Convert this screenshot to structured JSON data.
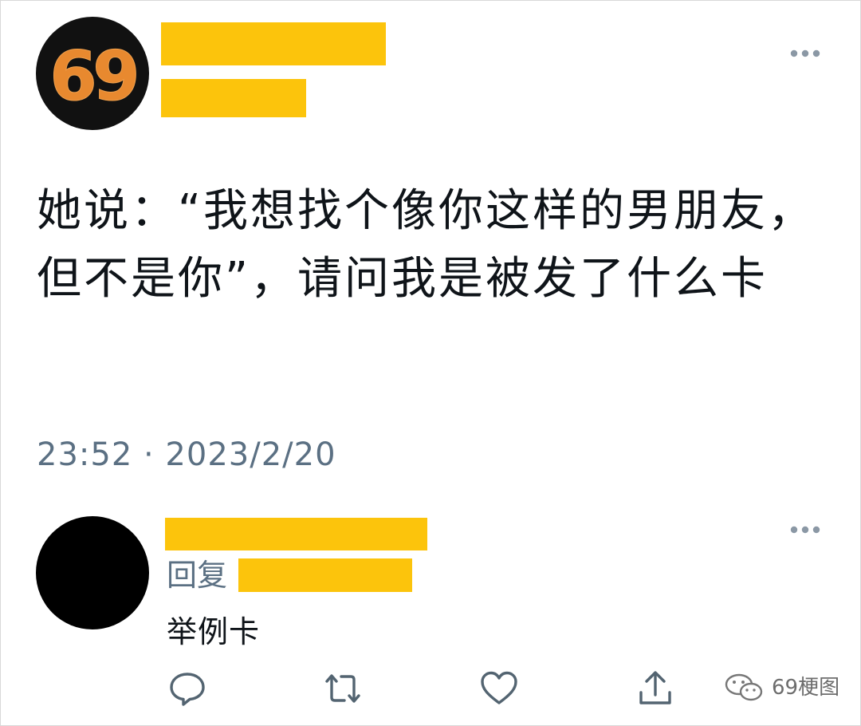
{
  "tweet": {
    "avatar_logo_text": "69",
    "text": "她说：“我想找个像你这样的男朋友，但不是你”，请问我是被发了什么卡",
    "timestamp": "23:52 · 2023/2/20",
    "menu_icon": "more-horizontal-icon"
  },
  "reply": {
    "reply_label": "回复",
    "text": "举例卡",
    "menu_icon": "more-horizontal-icon"
  },
  "actions": [
    {
      "name": "reply",
      "icon": "speech-bubble-icon"
    },
    {
      "name": "retweet",
      "icon": "retweet-icon"
    },
    {
      "name": "like",
      "icon": "heart-icon"
    },
    {
      "name": "share",
      "icon": "share-icon"
    }
  ],
  "watermark": {
    "icon": "wechat-icon",
    "text": "69梗图"
  },
  "colors": {
    "redaction": "#fcc40c",
    "logo_orange": "#e8892f",
    "secondary_text": "#5b7083",
    "icon_gray": "#536471"
  }
}
